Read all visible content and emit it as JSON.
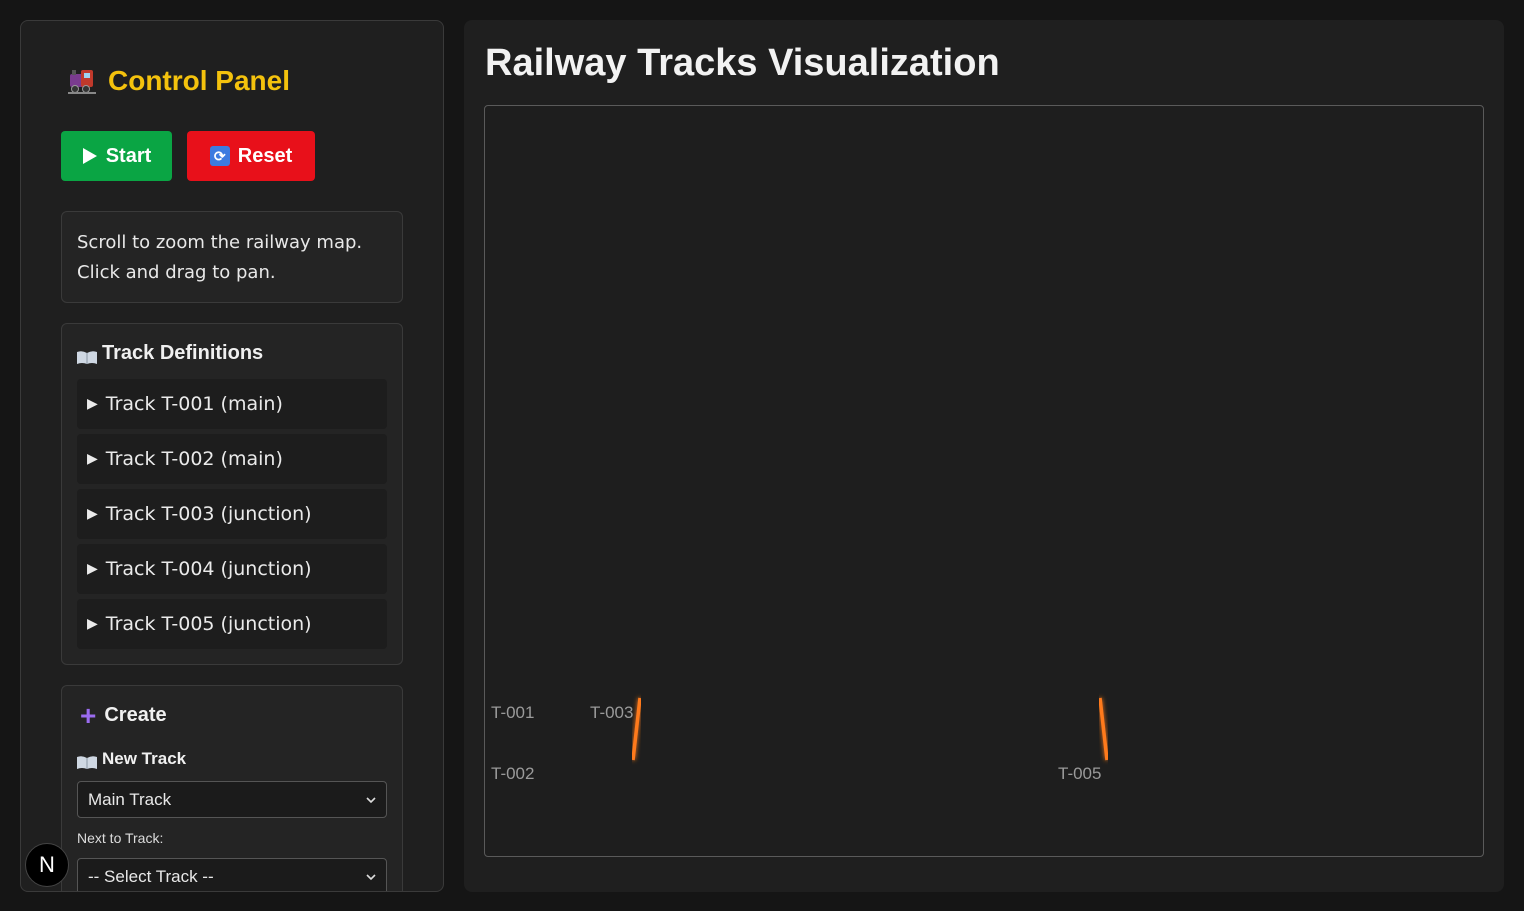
{
  "sidebar": {
    "title": "Control Panel",
    "start_label": "Start",
    "reset_label": "Reset",
    "help_line1": "Scroll to zoom the railway map.",
    "help_line2": "Click and drag to pan.",
    "definitions_title": "Track Definitions",
    "tracks": [
      {
        "label": "Track T-001 (main)"
      },
      {
        "label": "Track T-002 (main)"
      },
      {
        "label": "Track T-003 (junction)"
      },
      {
        "label": "Track T-004 (junction)"
      },
      {
        "label": "Track T-005 (junction)"
      }
    ],
    "create_title": "Create",
    "new_track_title": "New Track",
    "track_type_value": "Main Track",
    "next_to_label": "Next to Track:",
    "next_to_value": "-- Select Track --"
  },
  "badge": "N",
  "main": {
    "title": "Railway Tracks Visualization",
    "map_labels": {
      "t001": "T-001",
      "t002": "T-002",
      "t003": "T-003",
      "t005": "T-005"
    }
  },
  "colors": {
    "main_track": "#e03a2a",
    "junction_track": "#ff7a1a",
    "accent": "#f4c20d",
    "start": "#0aa544",
    "reset": "#e8101a"
  }
}
